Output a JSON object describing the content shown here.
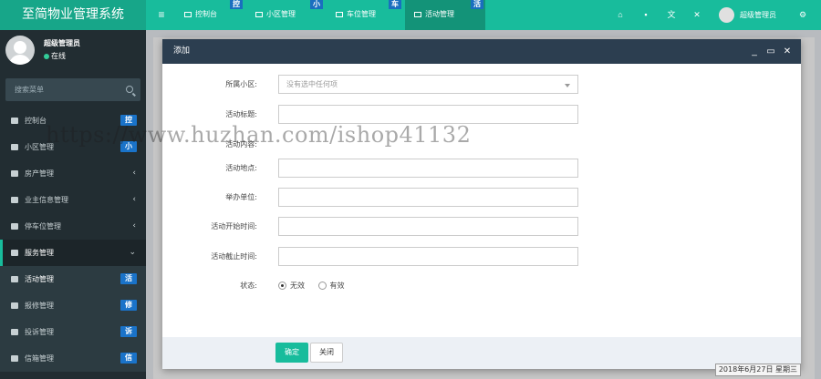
{
  "header": {
    "app_title": "至简物业管理系统",
    "tabs": [
      {
        "label": "控制台",
        "badge": "控"
      },
      {
        "label": "小区管理",
        "badge": "小"
      },
      {
        "label": "车位管理",
        "badge": "车"
      },
      {
        "label": "活动管理",
        "badge": "活"
      }
    ],
    "username": "超级管理员",
    "accent_color": "#18bc9c"
  },
  "sidebar": {
    "user_name": "超级管理员",
    "status": "在线",
    "search_placeholder": "搜索菜单",
    "items": [
      {
        "label": "控制台",
        "badge": "控",
        "icon": "dashboard-icon"
      },
      {
        "label": "小区管理",
        "badge": "小",
        "icon": "list-icon"
      },
      {
        "label": "房产管理",
        "arrow": "‹",
        "icon": "home-icon"
      },
      {
        "label": "业主信息管理",
        "arrow": "‹",
        "icon": "user-icon"
      },
      {
        "label": "停车位管理",
        "arrow": "‹",
        "icon": "parking-icon"
      },
      {
        "label": "服务管理",
        "arrow": "⌄",
        "icon": "service-icon"
      },
      {
        "label": "活动管理",
        "badge": "活",
        "icon": "list-icon"
      },
      {
        "label": "报修管理",
        "badge": "修",
        "icon": "list-icon"
      },
      {
        "label": "投诉管理",
        "badge": "诉",
        "icon": "list-icon"
      },
      {
        "label": "信箱管理",
        "badge": "信",
        "icon": "list-icon"
      }
    ]
  },
  "modal": {
    "title": "添加",
    "fields": [
      {
        "label": "所属小区:",
        "value": "没有选中任何项",
        "type": "select"
      },
      {
        "label": "活动标题:",
        "value": "",
        "type": "text"
      },
      {
        "label": "活动内容:",
        "value": "",
        "type": "text"
      },
      {
        "label": "活动地点:",
        "value": "",
        "type": "text"
      },
      {
        "label": "举办单位:",
        "value": "",
        "type": "text"
      },
      {
        "label": "活动开始时间:",
        "value": "",
        "type": "text"
      },
      {
        "label": "活动截止时间:",
        "value": "",
        "type": "text"
      }
    ],
    "status_label": "状态:",
    "status_options": [
      "无效",
      "有效"
    ],
    "status_selected": "无效",
    "confirm_label": "确定",
    "close_label": "关闭"
  },
  "watermark": "https://www.huzhan.com/ishop41132",
  "date_display": "2018年6月27日 星期三"
}
